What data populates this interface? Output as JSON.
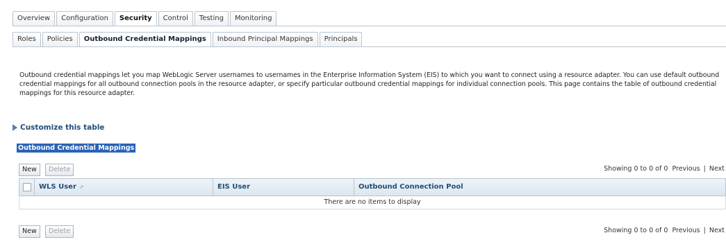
{
  "tabs_top": [
    "Overview",
    "Configuration",
    "Security",
    "Control",
    "Testing",
    "Monitoring"
  ],
  "tabs_top_active": "Security",
  "tabs_sub": [
    "Roles",
    "Policies",
    "Outbound Credential Mappings",
    "Inbound Principal Mappings",
    "Principals"
  ],
  "tabs_sub_active": "Outbound Credential Mappings",
  "description": "Outbound credential mappings let you map WebLogic Server usernames to usernames in the Enterprise Information System (EIS) to which you want to connect using a resource adapter. You can use default outbound credential mappings for all outbound connection pools in the resource adapter, or specify particular outbound credential mappings for individual connection pools. This page contains the table of outbound credential mappings for this resource adapter.",
  "customize_label": "Customize this table",
  "table_caption": "Outbound Credential Mappings",
  "toolbar": {
    "new_label": "New",
    "delete_label": "Delete",
    "showing": "Showing 0 to 0 of 0",
    "previous": "Previous",
    "separator": "|",
    "next": "Next"
  },
  "columns": [
    "WLS User",
    "EIS User",
    "Outbound Connection Pool"
  ],
  "empty_message": "There are no items to display",
  "colors": {
    "accent": "#1f4e79",
    "selection": "#2a63b8"
  }
}
